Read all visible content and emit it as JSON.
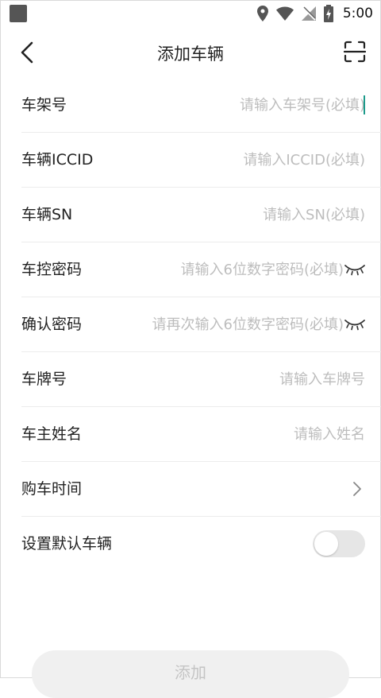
{
  "status_bar": {
    "time": "5:00",
    "icons": [
      "location-icon",
      "wifi-icon",
      "signal-off-icon",
      "battery-charging-icon"
    ]
  },
  "header": {
    "title": "添加车辆",
    "back_icon": "back-arrow-icon",
    "scan_icon": "scan-icon"
  },
  "form": {
    "rows": [
      {
        "label": "车架号",
        "placeholder": "请输入车架号(必填)"
      },
      {
        "label": "车辆ICCID",
        "placeholder": "请输入ICCID(必填)"
      },
      {
        "label": "车辆SN",
        "placeholder": "请输入SN(必填)"
      },
      {
        "label": "车控密码",
        "placeholder": "请输入6位数字密码(必填)"
      },
      {
        "label": "确认密码",
        "placeholder": "请再次输入6位数字密码(必填)"
      },
      {
        "label": "车牌号",
        "placeholder": "请输入车牌号"
      },
      {
        "label": "车主姓名",
        "placeholder": "请输入姓名"
      },
      {
        "label": "购车时间"
      },
      {
        "label": "设置默认车辆",
        "toggle_on": false
      }
    ]
  },
  "submit": {
    "label": "添加"
  },
  "colors": {
    "accent": "#1c9a8a",
    "placeholder": "#bdbdbd",
    "toggle_off": "#e6e6e6"
  }
}
